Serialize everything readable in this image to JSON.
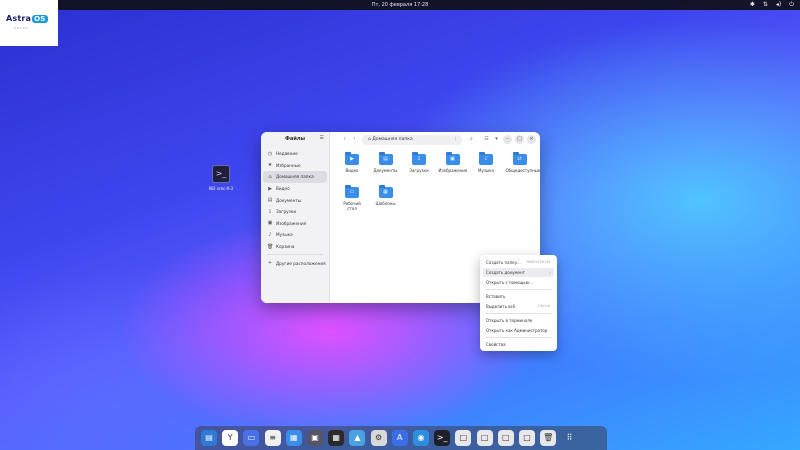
{
  "topbar": {
    "clock": "Пт, 20 февраля  17:28"
  },
  "tray": {
    "icons": [
      "accessibility-icon",
      "network-icon",
      "volume-icon",
      "power-icon"
    ]
  },
  "logo": {
    "brand": "Astra",
    "os": "OS",
    "tagline": "ASTRA"
  },
  "desktop": {
    "icon_label": "Nl2 vmc-X-3"
  },
  "file_manager": {
    "sidebar_title": "Файлы",
    "sidebar_items": [
      {
        "icon": "clock-icon",
        "label": "Недавние"
      },
      {
        "icon": "star-icon",
        "label": "Избранные"
      },
      {
        "icon": "home-icon",
        "label": "Домашняя папка",
        "active": true
      },
      {
        "icon": "video-icon",
        "label": "Видео"
      },
      {
        "icon": "document-icon",
        "label": "Документы"
      },
      {
        "icon": "download-icon",
        "label": "Загрузки"
      },
      {
        "icon": "image-icon",
        "label": "Изображения"
      },
      {
        "icon": "music-icon",
        "label": "Музыка"
      },
      {
        "icon": "trash-icon",
        "label": "Корзина"
      }
    ],
    "other_locations": "Другие расположения",
    "path": "Домашняя папка",
    "files": [
      {
        "name": "Видео",
        "icon": "video-icon"
      },
      {
        "name": "Документы",
        "icon": "document-icon"
      },
      {
        "name": "Загрузки",
        "icon": "download-icon"
      },
      {
        "name": "Изображения",
        "icon": "image-icon"
      },
      {
        "name": "Музыка",
        "icon": "music-icon"
      },
      {
        "name": "Общедоступные",
        "icon": "share-icon"
      },
      {
        "name": "Рабочий стол",
        "icon": "desktop-icon"
      },
      {
        "name": "Шаблоны",
        "icon": "template-icon"
      }
    ]
  },
  "context_menu": {
    "items": [
      {
        "label": "Создать папку...",
        "shortcut": "Shift+Ctrl+N"
      },
      {
        "label": "Создать документ",
        "shortcut": "",
        "submenu": true,
        "highlighted": true
      },
      {
        "label": "Открыть с помощью...",
        "shortcut": ""
      },
      {
        "label": "Вставить",
        "shortcut": ""
      },
      {
        "label": "Выделить всё",
        "shortcut": "Ctrl+A"
      },
      {
        "label": "Открыть в терминале",
        "shortcut": ""
      },
      {
        "label": "Открыть как Администратор",
        "shortcut": ""
      },
      {
        "label": "Свойства",
        "shortcut": ""
      }
    ]
  },
  "dock": {
    "icons": [
      "file-manager-icon",
      "yandex-browser-icon",
      "window-icon",
      "notes-icon",
      "browser-icon",
      "image-viewer-icon",
      "calculator-icon",
      "photos-icon",
      "settings-icon",
      "app-store-icon",
      "web-browser-icon",
      "terminal-icon",
      "app-icon",
      "app-icon",
      "app-icon",
      "app-icon",
      "trash-icon",
      "app-grid-icon"
    ]
  }
}
